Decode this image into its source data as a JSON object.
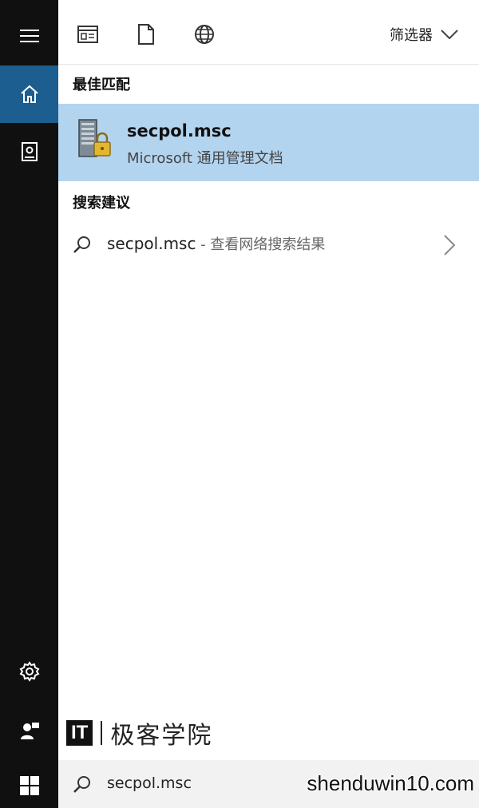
{
  "sidebar": {
    "items": [
      {
        "name": "menu",
        "icon": "hamburger-icon"
      },
      {
        "name": "home",
        "icon": "home-icon",
        "active": true
      },
      {
        "name": "notebook",
        "icon": "notebook-icon"
      },
      {
        "name": "settings",
        "icon": "gear-icon"
      },
      {
        "name": "feedback",
        "icon": "feedback-icon"
      },
      {
        "name": "start",
        "icon": "windows-icon"
      }
    ],
    "accent": "#1b5e8f"
  },
  "toolbar": {
    "icons": [
      "apps-icon",
      "documents-icon",
      "web-icon"
    ],
    "filter_label": "筛选器"
  },
  "best_match": {
    "heading": "最佳匹配",
    "title": "secpol.msc",
    "subtitle": "Microsoft 通用管理文档",
    "highlight_color": "#b3d4ef"
  },
  "suggestions": {
    "heading": "搜索建议",
    "items": [
      {
        "query": "secpol.msc",
        "suffix": " - 查看网络搜索结果"
      }
    ]
  },
  "watermark": {
    "logo": "IT",
    "text": "极客学院"
  },
  "search": {
    "value": "secpol.msc"
  },
  "site_watermark": "shenduwin10.com"
}
